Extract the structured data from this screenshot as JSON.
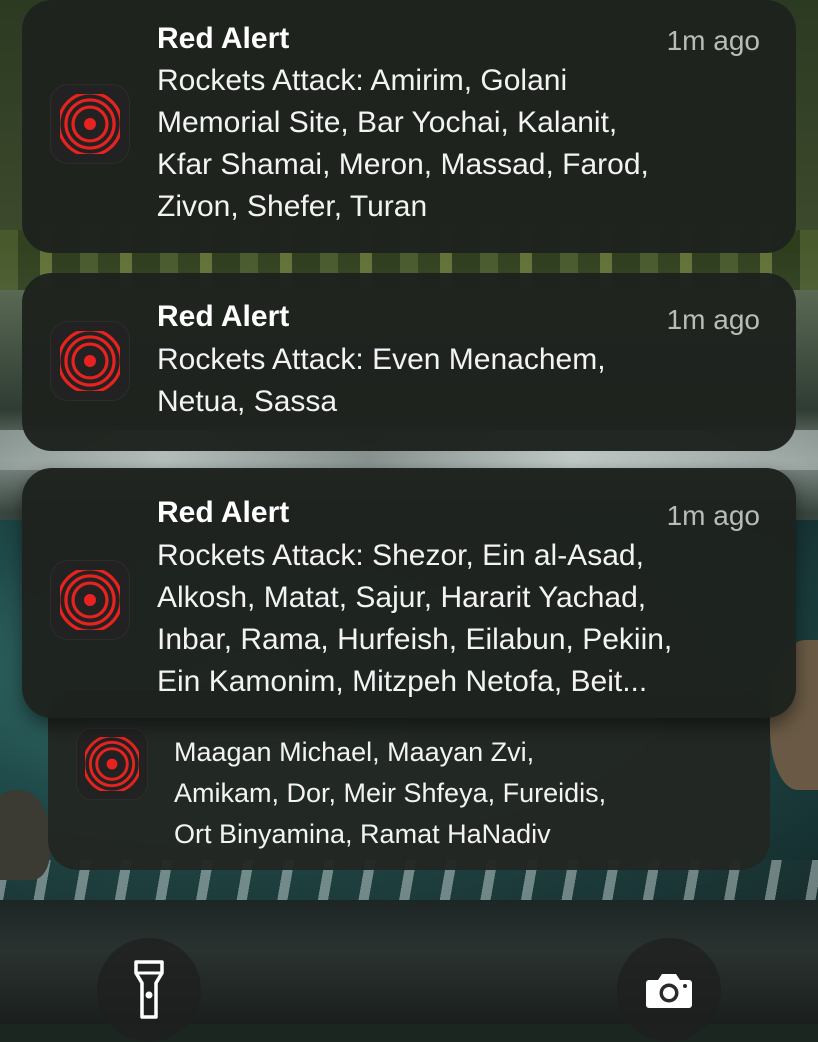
{
  "notifications": [
    {
      "app": "Red Alert",
      "time": "1m ago",
      "icon": "red-alert-siren-icon",
      "lines": [
        "Rockets Attack: Amirim, Golani",
        "Memorial Site, Bar Yochai, Kalanit,",
        "Kfar Shamai, Meron, Massad, Farod,",
        "Zivon, Shefer, Turan"
      ]
    },
    {
      "app": "Red Alert",
      "time": "1m ago",
      "icon": "red-alert-siren-icon",
      "lines": [
        "Rockets Attack: Even Menachem,",
        "Netua, Sassa"
      ]
    },
    {
      "app": "Red Alert",
      "time": "1m ago",
      "icon": "red-alert-siren-icon",
      "lines": [
        "Rockets Attack: Shezor, Ein al-Asad,",
        "Alkosh, Matat, Sajur, Hararit Yachad,",
        "Inbar, Rama, Hurfeish, Eilabun, Pekiin,",
        "Ein Kamonim, Mitzpeh Netofa, Beit..."
      ]
    },
    {
      "icon": "red-alert-siren-icon",
      "lines": [
        "Maagan Michael, Maayan Zvi,",
        "Amikam, Dor, Meir Shfeya, Fureidis,",
        "Ort Binyamina, Ramat HaNadiv"
      ]
    }
  ],
  "controls": {
    "flashlight": "flashlight-icon",
    "camera": "camera-icon"
  },
  "colors": {
    "siren_red": "#e8231f",
    "card_bg": "#1e221e",
    "time_gray": "#b9bcb8"
  }
}
